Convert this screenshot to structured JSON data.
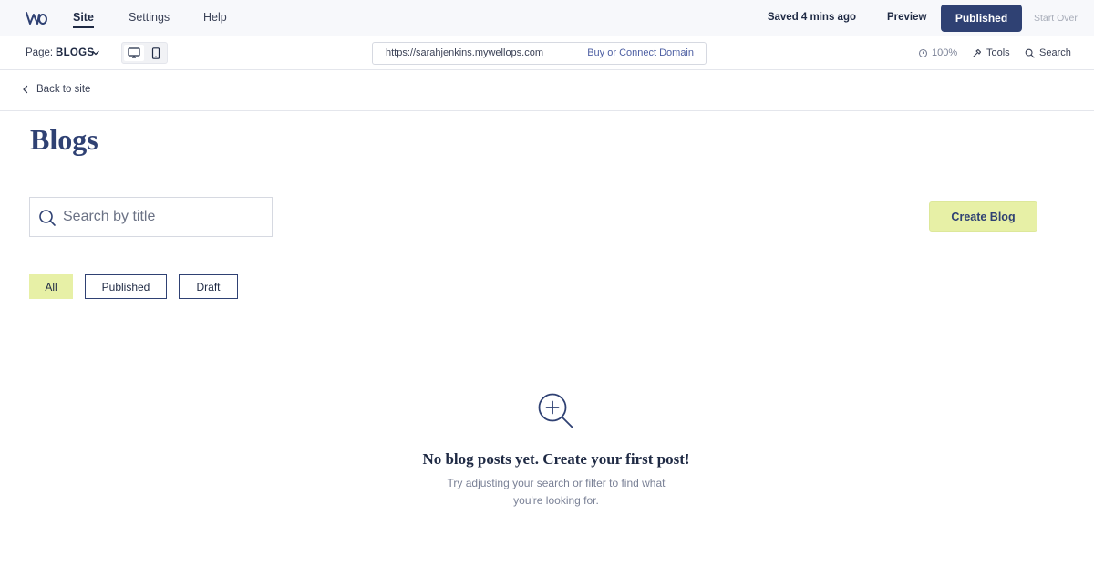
{
  "topbar": {
    "nav": {
      "site": "Site",
      "settings": "Settings",
      "help": "Help"
    },
    "saved_status": "Saved 4 mins ago",
    "preview_label": "Preview",
    "publish_label": "Published",
    "start_over_label": "Start Over"
  },
  "toolbar": {
    "page_label": "Page:",
    "page_value": "BLOGS",
    "url": "https://sarahjenkins.mywellops.com",
    "domain_link": "Buy or Connect Domain",
    "zoom": "100%",
    "tools_label": "Tools",
    "search_label": "Search"
  },
  "back_link": "Back to site",
  "main": {
    "title": "Blogs",
    "search_placeholder": "Search by title",
    "create_label": "Create Blog",
    "filters": [
      "All",
      "Published",
      "Draft"
    ]
  },
  "empty_state": {
    "title": "No blog posts yet. Create your first post!",
    "description": "Try adjusting your search or filter to find what you're looking for."
  },
  "colors": {
    "primary": "#2f4173",
    "accent": "#e7f0a6",
    "text": "#1f2a44",
    "muted": "#7a8196"
  },
  "icons": {
    "logo": "wellops-logo",
    "page_dropdown": "chevron-down-icon",
    "desktop": "desktop-icon",
    "mobile": "mobile-icon",
    "zoom": "zoom-icon",
    "tools": "hammer-icon",
    "search": "search-icon",
    "back": "chevron-left-icon",
    "empty": "zoom-in-icon"
  }
}
